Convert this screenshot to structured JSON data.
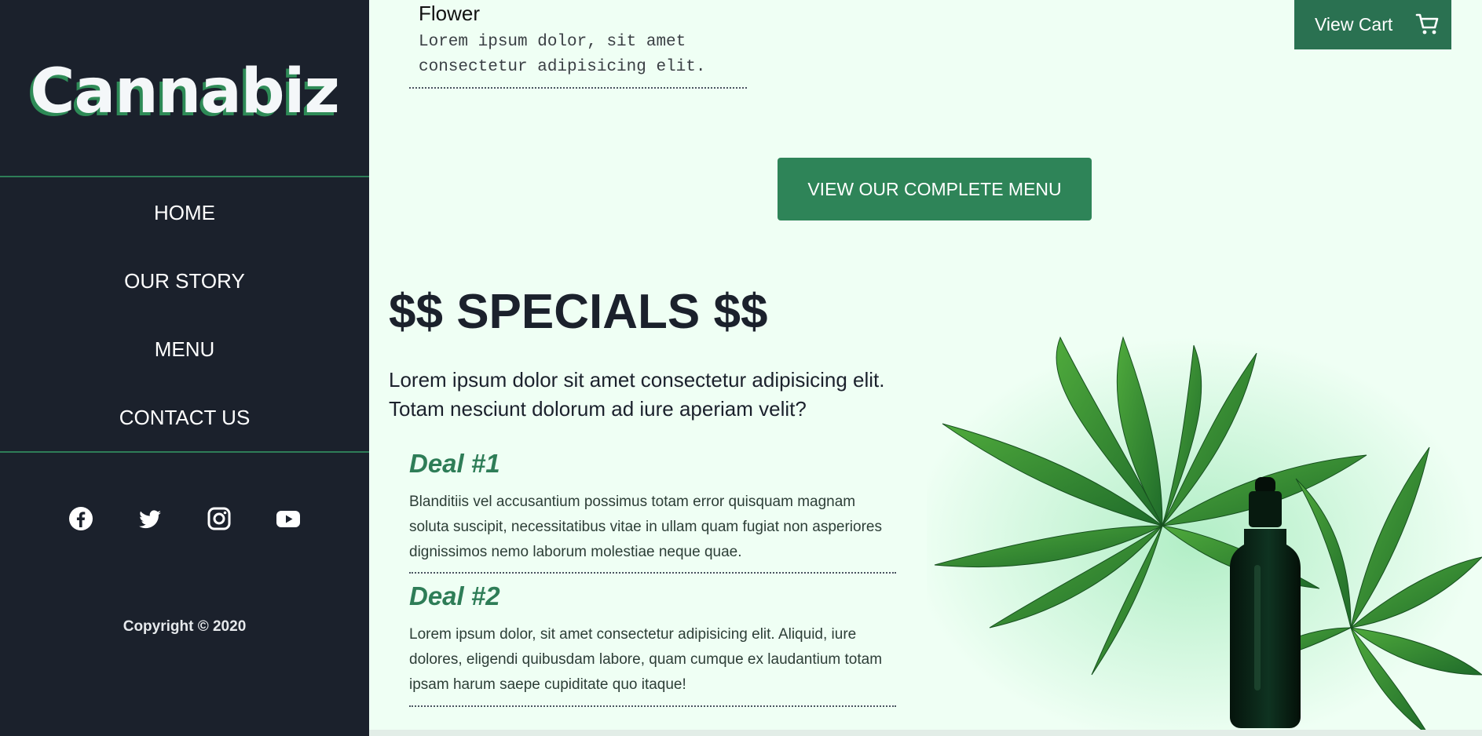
{
  "brand": {
    "logo_text": "Cannabiz",
    "accent": "#2e8b57",
    "sidebar_bg": "#1b212c",
    "page_bg": "#effff4"
  },
  "nav": {
    "items": [
      {
        "label": "HOME"
      },
      {
        "label": "OUR STORY"
      },
      {
        "label": "MENU"
      },
      {
        "label": "CONTACT US"
      }
    ]
  },
  "social": {
    "icons": [
      "facebook-icon",
      "twitter-icon",
      "instagram-icon",
      "youtube-icon"
    ]
  },
  "footer": {
    "copyright": "Copyright © 2020"
  },
  "header": {
    "view_cart_label": "View Cart",
    "cart_icon": "cart-icon"
  },
  "menu_item": {
    "title": "Flower",
    "description": "Lorem ipsum dolor, sit amet consectetur adipisicing elit."
  },
  "menu_button_label": "VIEW OUR COMPLETE MENU",
  "specials": {
    "title": "$$ SPECIALS $$",
    "intro": "Lorem ipsum dolor sit amet consectetur adipisicing elit. Totam nesciunt dolorum ad iure aperiam velit?",
    "deals": [
      {
        "title": "Deal #1",
        "text": "Blanditiis vel accusantium possimus totam error quisquam magnam soluta suscipit, necessitatibus vitae in ullam quam fugiat non asperiores dignissimos nemo laborum molestiae neque quae."
      },
      {
        "title": "Deal #2",
        "text": "Lorem ipsum dolor, sit amet consectetur adipisicing elit. Aliquid, iure dolores, eligendi quibusdam labore, quam cumque ex laudantium totam ipsam harum saepe cupiditate quo itaque!"
      }
    ]
  }
}
